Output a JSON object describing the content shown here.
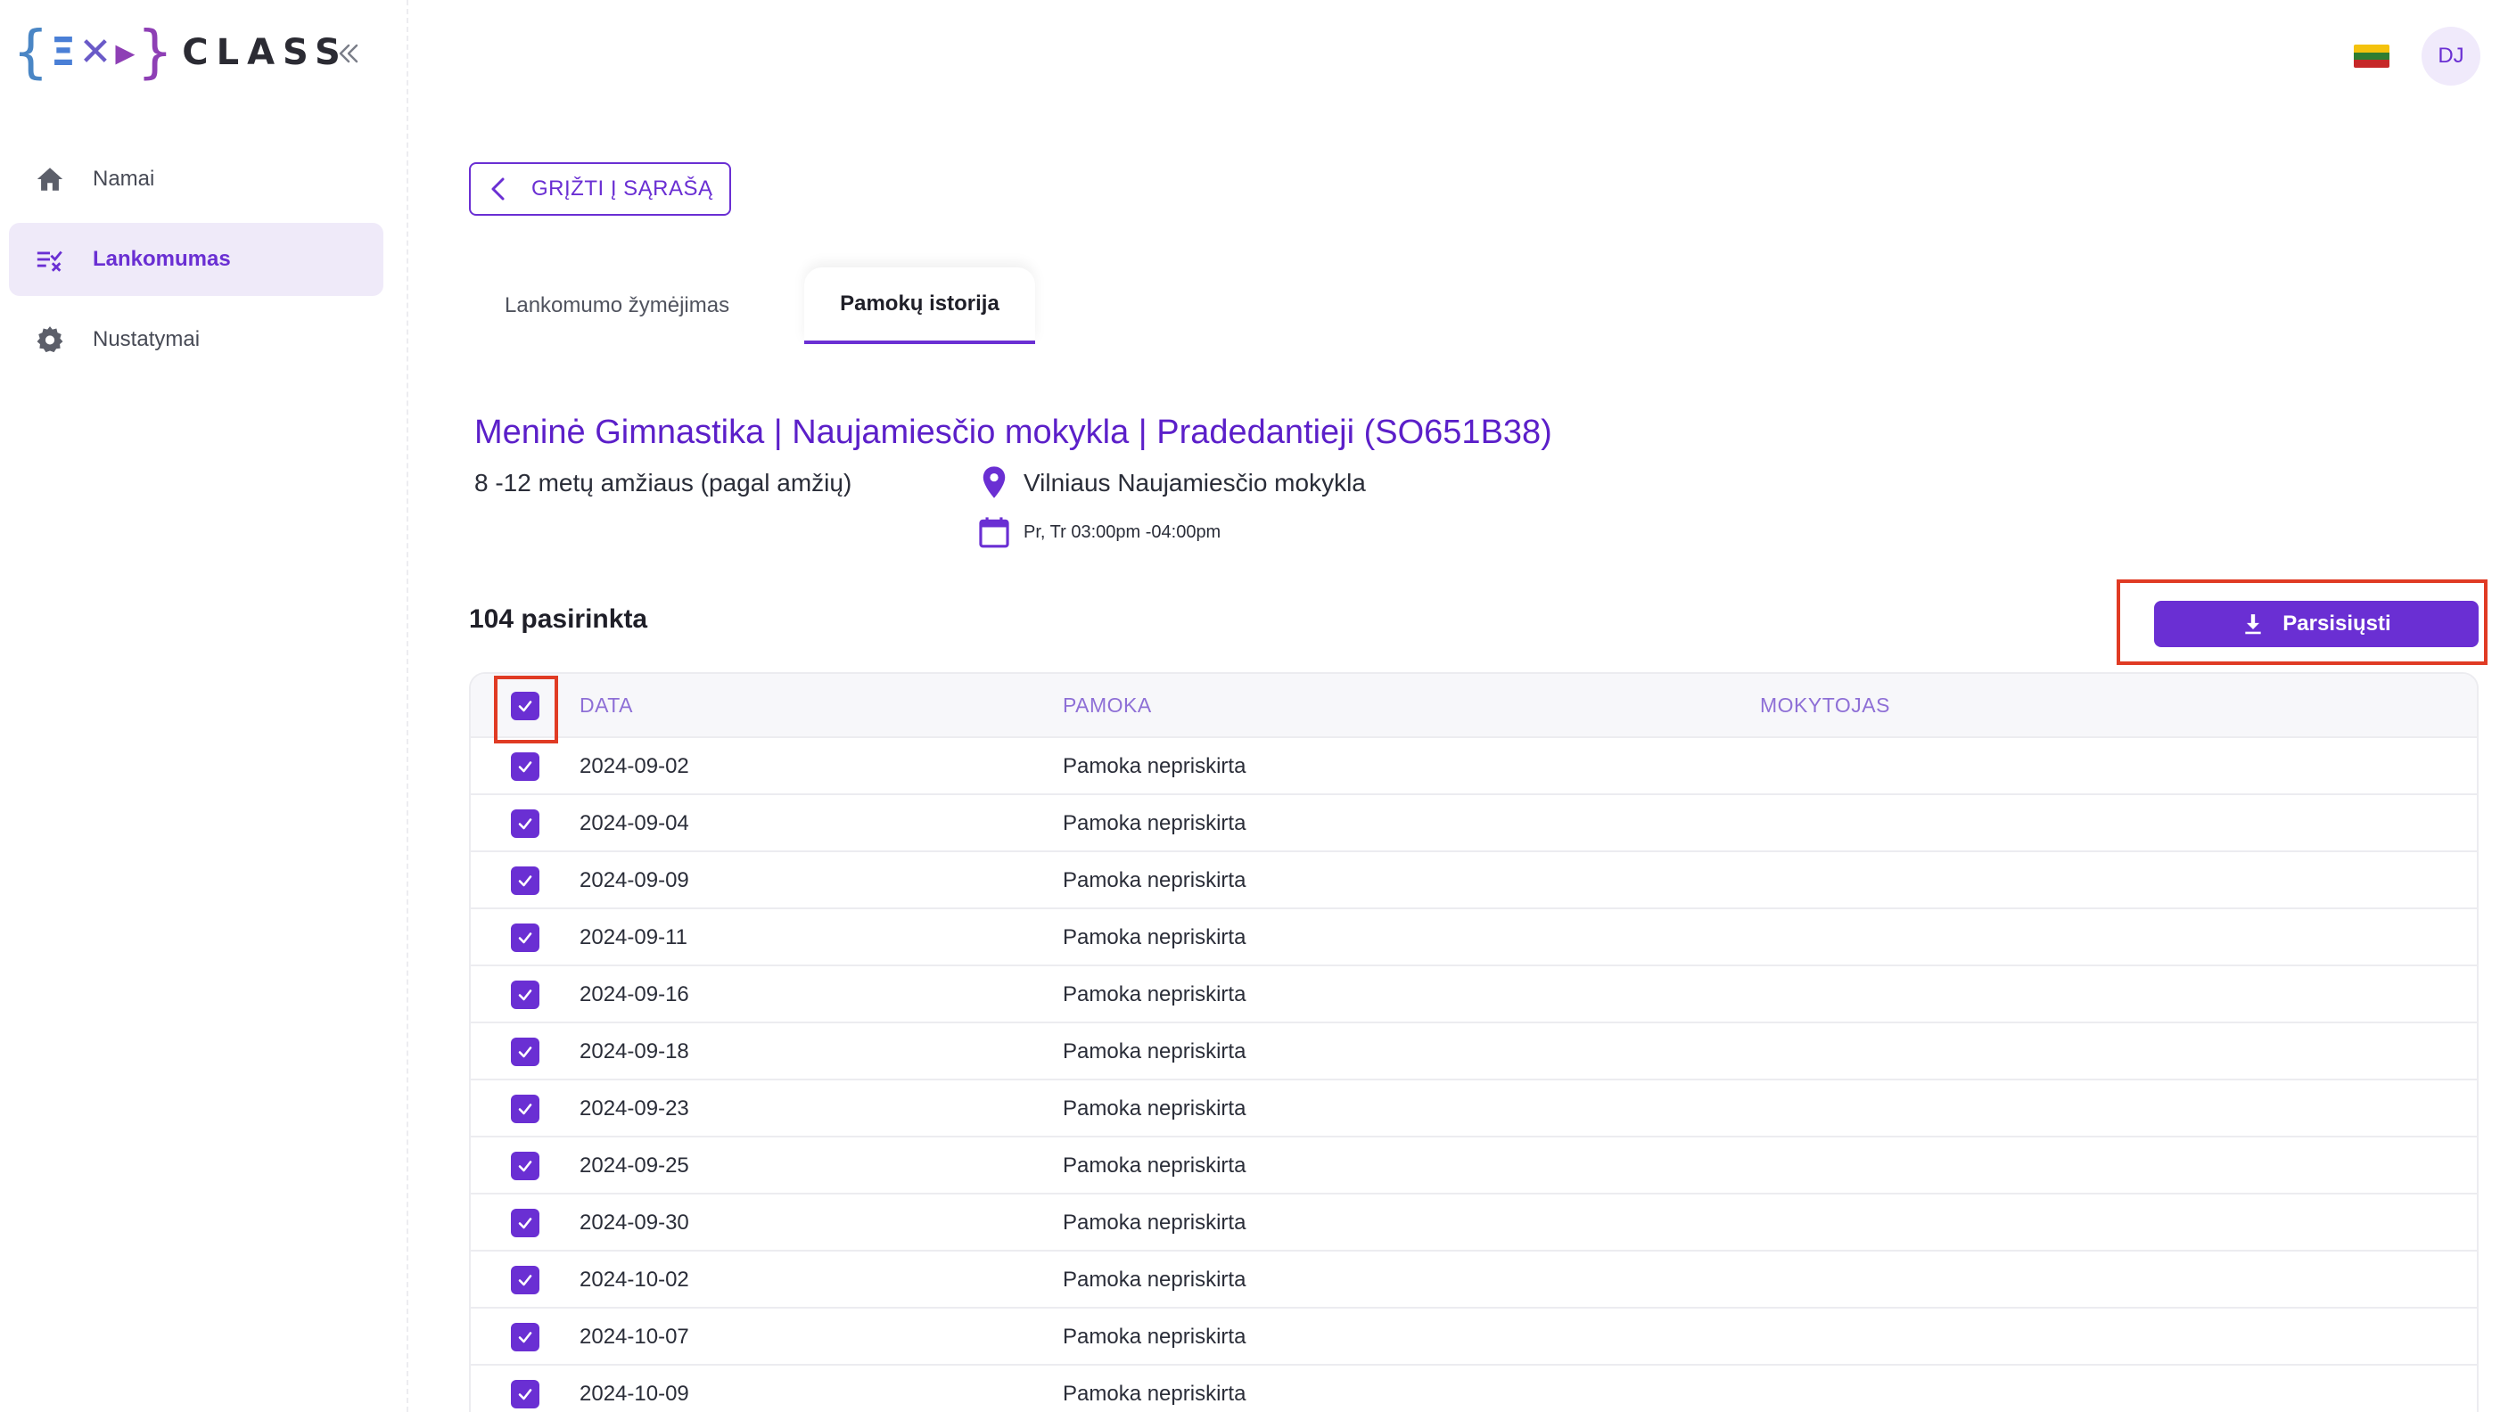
{
  "brand": {
    "word": "CLASS"
  },
  "sidebar": {
    "items": [
      {
        "label": "Namai",
        "icon": "home-icon",
        "active": false
      },
      {
        "label": "Lankomumas",
        "icon": "attendance-icon",
        "active": true
      },
      {
        "label": "Nustatymai",
        "icon": "gear-icon",
        "active": false
      }
    ]
  },
  "header": {
    "avatar_initials": "DJ",
    "language_flag": "lithuania-flag-icon"
  },
  "back_button": {
    "label": "GRĮŽTI Į SĄRAŠĄ"
  },
  "tabs": [
    {
      "label": "Lankomumo žymėjimas",
      "active": false
    },
    {
      "label": "Pamokų istorija",
      "active": true
    }
  ],
  "course": {
    "title": "Meninė Gimnastika | Naujamiesčio mokykla | Pradedantieji (SO651B38)",
    "age_group": "8 -12 metų amžiaus (pagal amžių)",
    "location": "Vilniaus Naujamiesčio mokykla",
    "schedule": "Pr, Tr 03:00pm -04:00pm"
  },
  "selection": {
    "count_label": "104 pasirinkta"
  },
  "download_button": {
    "label": "Parsisiųsti"
  },
  "table": {
    "columns": [
      "DATA",
      "PAMOKA",
      "MOKYTOJAS"
    ],
    "header_checked": true,
    "rows": [
      {
        "date": "2024-09-02",
        "lesson": "Pamoka nepriskirta",
        "teacher": "",
        "checked": true
      },
      {
        "date": "2024-09-04",
        "lesson": "Pamoka nepriskirta",
        "teacher": "",
        "checked": true
      },
      {
        "date": "2024-09-09",
        "lesson": "Pamoka nepriskirta",
        "teacher": "",
        "checked": true
      },
      {
        "date": "2024-09-11",
        "lesson": "Pamoka nepriskirta",
        "teacher": "",
        "checked": true
      },
      {
        "date": "2024-09-16",
        "lesson": "Pamoka nepriskirta",
        "teacher": "",
        "checked": true
      },
      {
        "date": "2024-09-18",
        "lesson": "Pamoka nepriskirta",
        "teacher": "",
        "checked": true
      },
      {
        "date": "2024-09-23",
        "lesson": "Pamoka nepriskirta",
        "teacher": "",
        "checked": true
      },
      {
        "date": "2024-09-25",
        "lesson": "Pamoka nepriskirta",
        "teacher": "",
        "checked": true
      },
      {
        "date": "2024-09-30",
        "lesson": "Pamoka nepriskirta",
        "teacher": "",
        "checked": true
      },
      {
        "date": "2024-10-02",
        "lesson": "Pamoka nepriskirta",
        "teacher": "",
        "checked": true
      },
      {
        "date": "2024-10-07",
        "lesson": "Pamoka nepriskirta",
        "teacher": "",
        "checked": true
      },
      {
        "date": "2024-10-09",
        "lesson": "Pamoka nepriskirta",
        "teacher": "",
        "checked": true
      }
    ]
  },
  "colors": {
    "accent": "#6a2fd3",
    "title": "#5b1fc9",
    "highlight_frame": "#e03b24",
    "sidebar_active_bg": "#efeaf9",
    "column_header": "#8e6fd6"
  }
}
